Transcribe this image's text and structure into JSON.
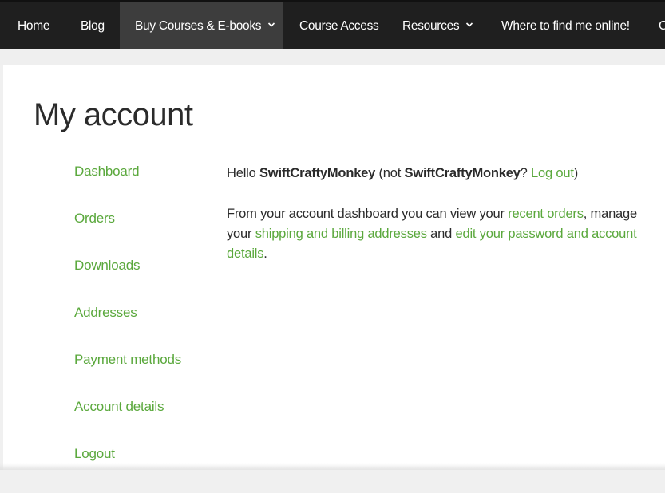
{
  "nav": {
    "items": [
      {
        "label": "Home"
      },
      {
        "label": "Blog"
      },
      {
        "label": "Buy Courses & E-books",
        "active": true,
        "has_dropdown": true
      },
      {
        "label": "Course Access"
      },
      {
        "label": "Resources",
        "has_dropdown": true
      },
      {
        "label": "Where to find me online!"
      },
      {
        "label": "C"
      }
    ],
    "background": "#1f1f1f",
    "active_background": "#3d3d3d"
  },
  "page": {
    "title": "My account"
  },
  "account_nav": {
    "items": [
      {
        "label": "Dashboard"
      },
      {
        "label": "Orders"
      },
      {
        "label": "Downloads"
      },
      {
        "label": "Addresses"
      },
      {
        "label": "Payment methods"
      },
      {
        "label": "Account details"
      },
      {
        "label": "Logout"
      }
    ],
    "link_color": "#5aa83c"
  },
  "dashboard": {
    "greeting": {
      "hello": "Hello",
      "username": "SwiftCraftyMonkey",
      "not_prefix": "(not",
      "not_username": "SwiftCraftyMonkey",
      "question": "?",
      "logout_link": "Log out",
      "close": ")"
    },
    "intro": {
      "part1": "From your account dashboard you can view your",
      "recent_orders_link": "recent orders",
      "part2": ", manage your",
      "addresses_link": "shipping and billing addresses",
      "part3": "and",
      "account_link": "edit your password and account details",
      "part4": "."
    }
  }
}
